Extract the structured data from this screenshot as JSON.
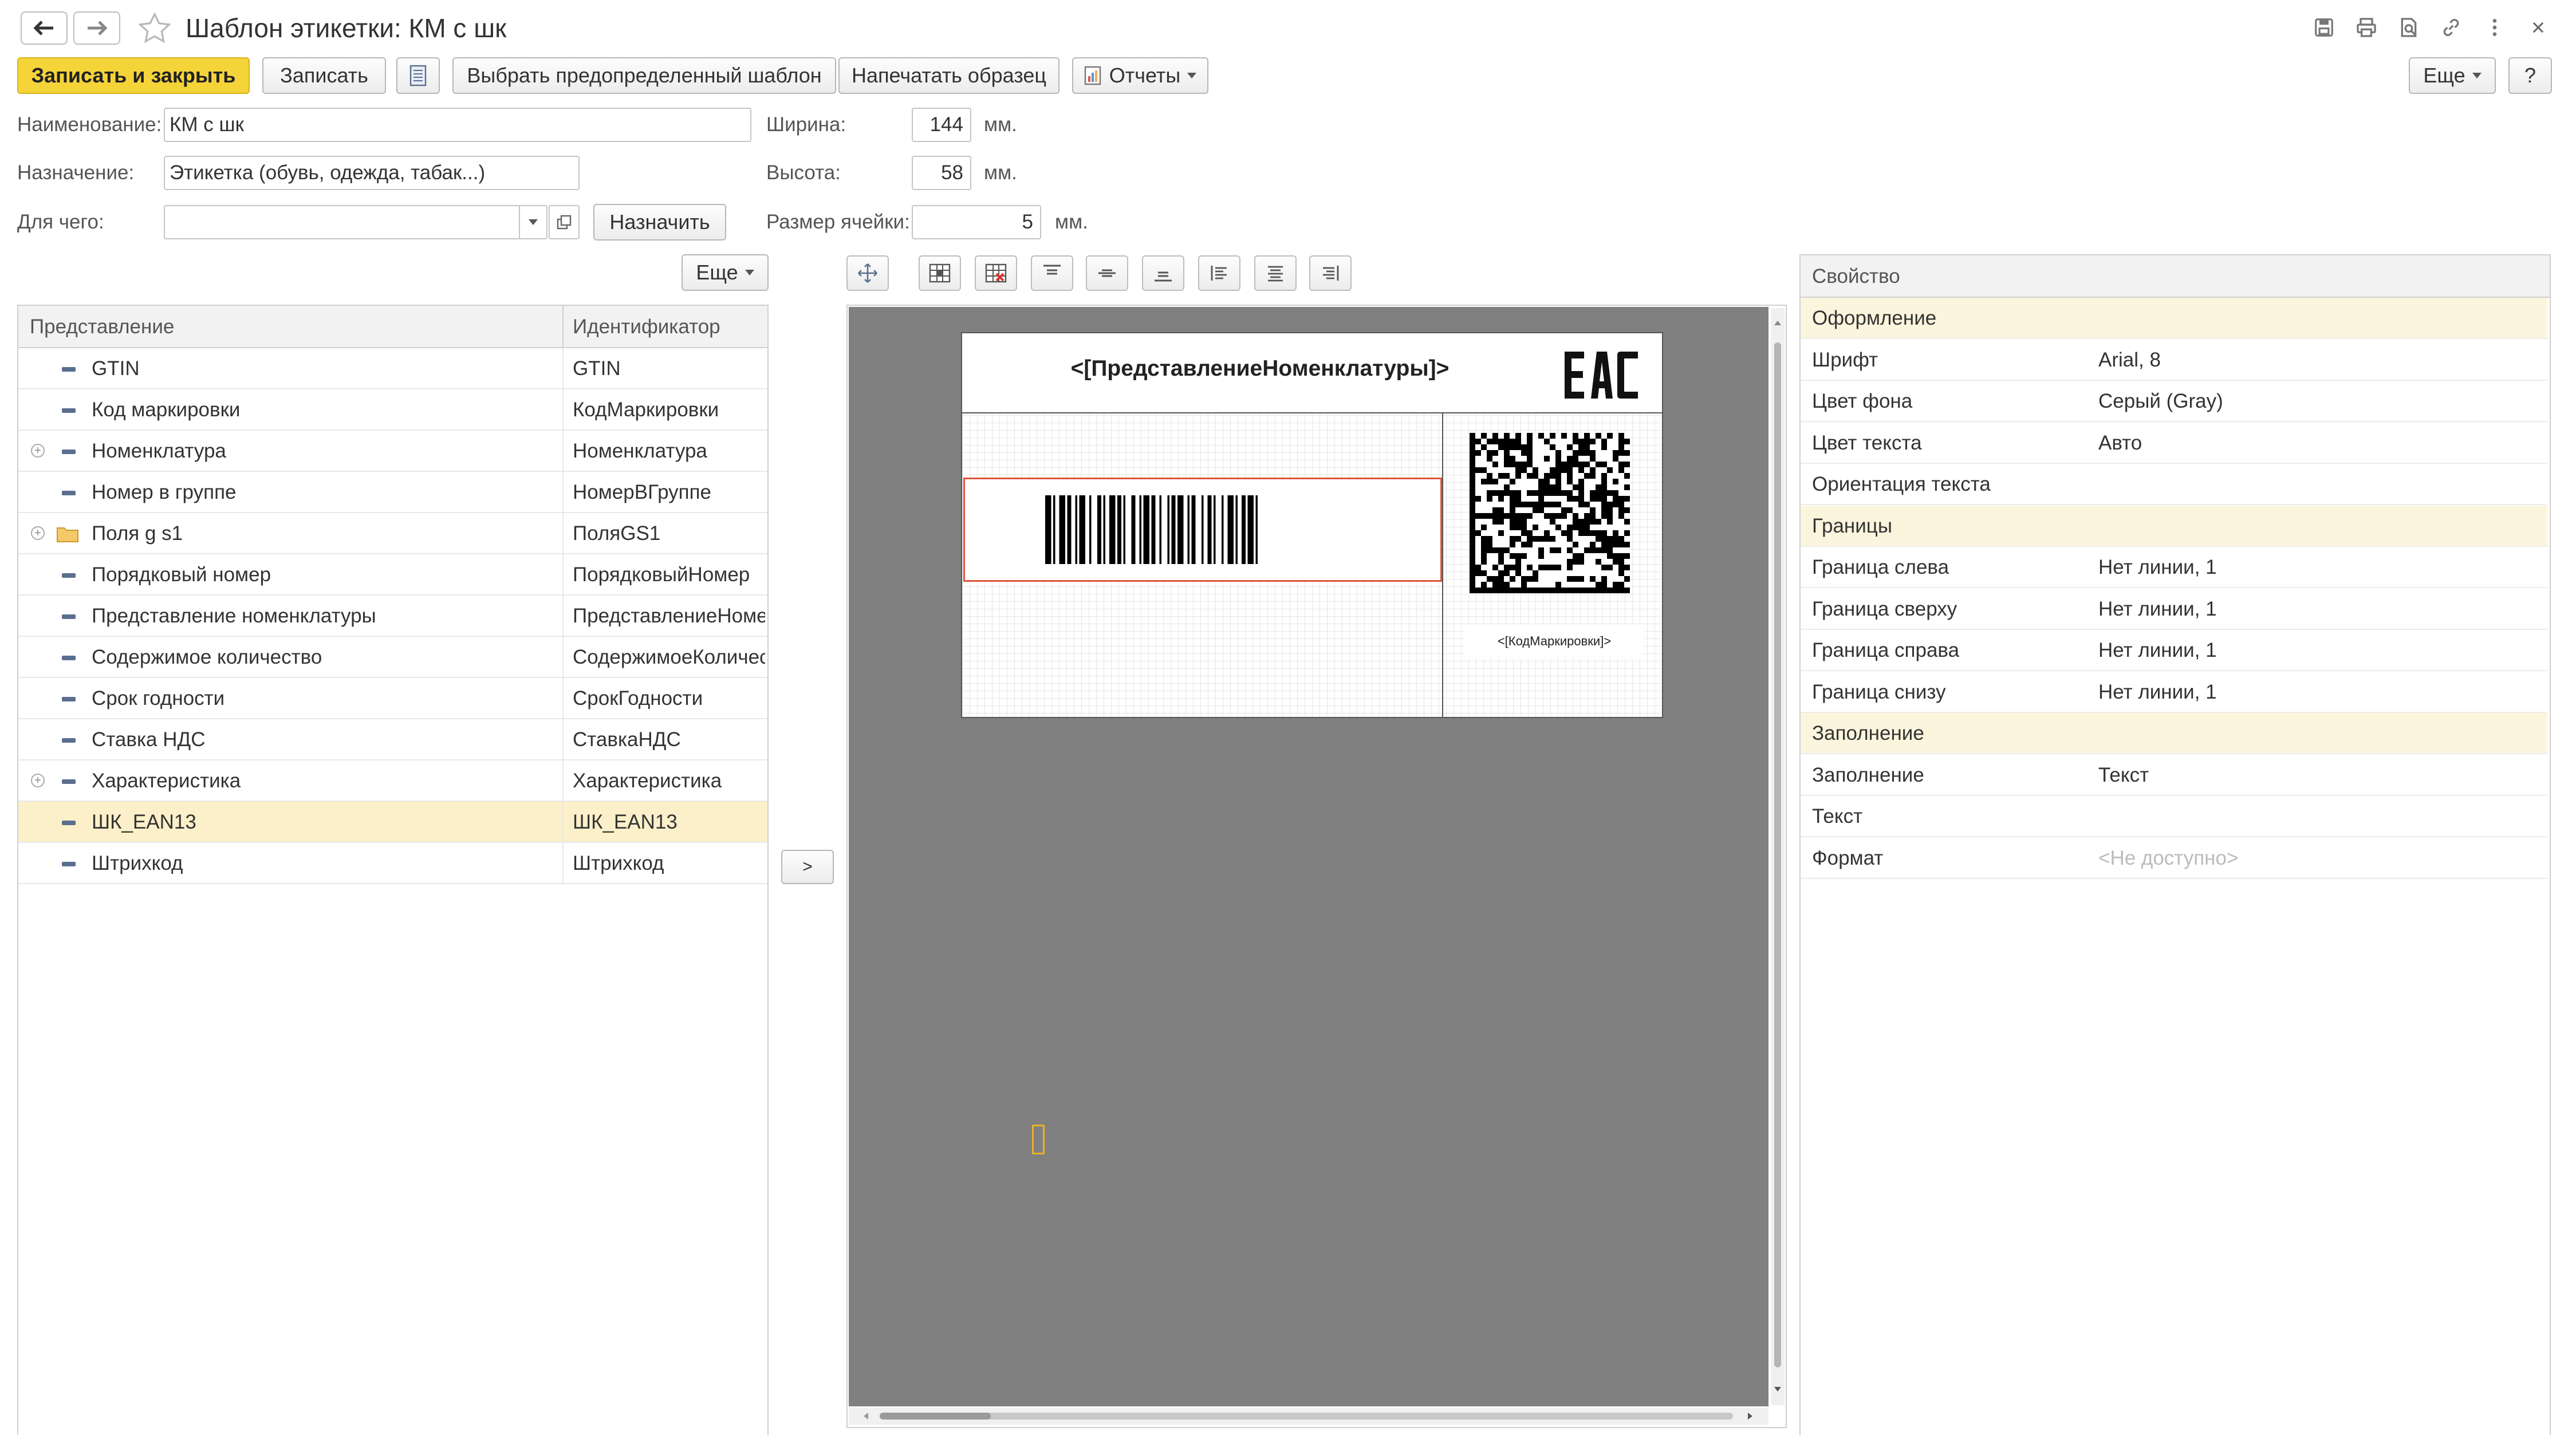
{
  "window": {
    "title": "Шаблон этикетки: КМ с шк"
  },
  "toolbar": {
    "save_close": "Записать и закрыть",
    "save": "Записать",
    "choose_template": "Выбрать предопределенный шаблон",
    "print_sample": "Напечатать образец",
    "reports": "Отчеты",
    "more": "Еще",
    "help": "?"
  },
  "form": {
    "name_label": "Наименование:",
    "name_value": "КМ с шк",
    "purpose_label": "Назначение:",
    "purpose_value": "Этикетка (обувь, одежда, табак...)",
    "for_label": "Для чего:",
    "for_value": "",
    "assign_button": "Назначить",
    "width_label": "Ширина:",
    "width_value": "144",
    "height_label": "Высота:",
    "height_value": "58",
    "cell_label": "Размер ячейки:",
    "cell_value": "5",
    "unit": "мм.",
    "unit2": "мм.",
    "unit3": "мм."
  },
  "fields_panel": {
    "more": "Еще",
    "col_presentation": "Представление",
    "col_identifier": "Идентификатор",
    "rows": [
      {
        "label": "GTIN",
        "id": "GTIN",
        "expandable": false,
        "folder": false
      },
      {
        "label": "Код маркировки",
        "id": "КодМаркировки",
        "expandable": false,
        "folder": false
      },
      {
        "label": "Номенклатура",
        "id": "Номенклатура",
        "expandable": true,
        "folder": false
      },
      {
        "label": "Номер в группе",
        "id": "НомерВГруппе",
        "expandable": false,
        "folder": false
      },
      {
        "label": "Поля g s1",
        "id": "ПоляGS1",
        "expandable": true,
        "folder": true
      },
      {
        "label": "Порядковый номер",
        "id": "ПорядковыйНомер",
        "expandable": false,
        "folder": false
      },
      {
        "label": "Представление номенклатуры",
        "id": "ПредставлениеНомен",
        "expandable": false,
        "folder": false
      },
      {
        "label": "Содержимое количество",
        "id": "СодержимоеКоличест",
        "expandable": false,
        "folder": false
      },
      {
        "label": "Срок годности",
        "id": "СрокГодности",
        "expandable": false,
        "folder": false
      },
      {
        "label": "Ставка НДС",
        "id": "СтавкаНДС",
        "expandable": false,
        "folder": false
      },
      {
        "label": "Характеристика",
        "id": "Характеристика",
        "expandable": true,
        "folder": false
      },
      {
        "label": "ШК_EAN13",
        "id": "ШК_EAN13",
        "expandable": false,
        "folder": false,
        "selected": true
      },
      {
        "label": "Штрихкод",
        "id": "Штрихкод",
        "expandable": false,
        "folder": false
      }
    ],
    "add_arrow": ">"
  },
  "label_preview": {
    "product_placeholder": "<[ПредставлениеНоменклатуры]>",
    "eac_logo": "EAC",
    "code_placeholder": "<[КодМаркировки]>",
    "canvas_color": "#808080",
    "selection_color": "#e0543a"
  },
  "properties": {
    "header": "Свойство",
    "rows": [
      {
        "name": "Оформление",
        "value": "",
        "group": true
      },
      {
        "name": "Шрифт",
        "value": "Arial, 8"
      },
      {
        "name": "Цвет фона",
        "value": "Серый (Gray)"
      },
      {
        "name": "Цвет текста",
        "value": "Авто"
      },
      {
        "name": "Ориентация текста",
        "value": ""
      },
      {
        "name": "Границы",
        "value": "",
        "group": true
      },
      {
        "name": "Граница слева",
        "value": "Нет линии, 1"
      },
      {
        "name": "Граница сверху",
        "value": "Нет линии, 1"
      },
      {
        "name": "Граница справа",
        "value": "Нет линии, 1"
      },
      {
        "name": "Граница снизу",
        "value": "Нет линии, 1"
      },
      {
        "name": "Заполнение",
        "value": "",
        "group": true
      },
      {
        "name": "Заполнение",
        "value": "Текст"
      },
      {
        "name": "Текст",
        "value": ""
      },
      {
        "name": "Формат",
        "value": "<Не доступно>",
        "disabled": true
      }
    ]
  },
  "colors": {
    "accent_yellow": "#f5d43a",
    "selected_row": "#fbf0c9",
    "group_row": "#fbf5dd"
  }
}
